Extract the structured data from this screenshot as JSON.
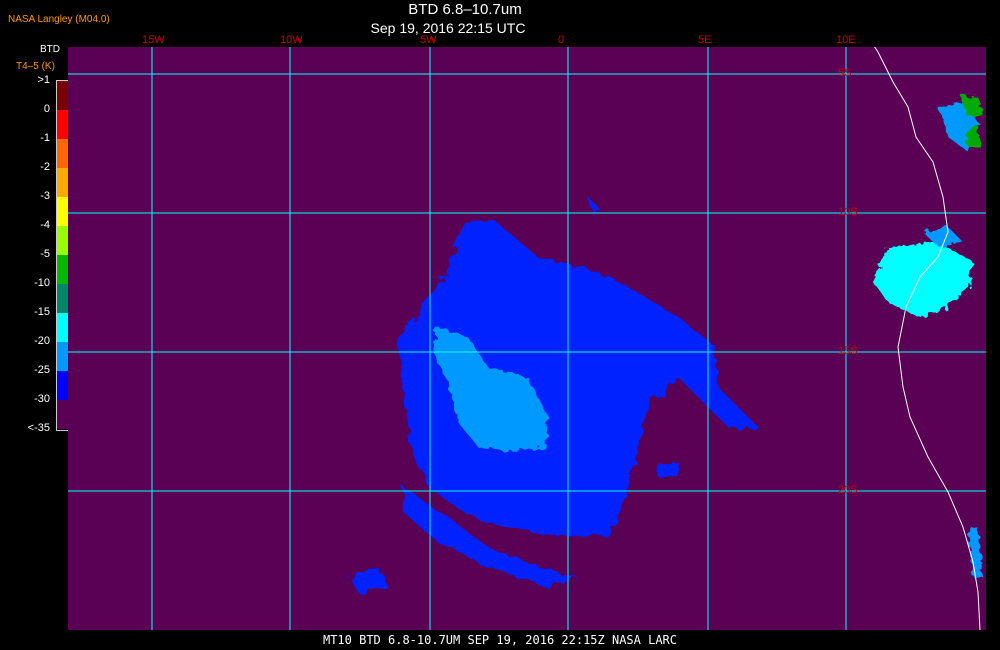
{
  "header": {
    "credit": "NASA Langley (M04.0)",
    "title": "BTD 6.8–10.7um",
    "timestamp": "Sep 19, 2016 22:15 UTC"
  },
  "legend": {
    "header": "BTD",
    "units": "T4–5 (K)",
    "colors": [
      "#7a0000",
      "#ff0000",
      "#ff6600",
      "#ffaa00",
      "#ffff00",
      "#99ff00",
      "#00bb00",
      "#008866",
      "#00ffff",
      "#0099ff",
      "#0000ff",
      "#5a0055"
    ],
    "labels": [
      ">1",
      "0",
      "-1",
      "-2",
      "-3",
      "-4",
      "-5",
      "-10",
      "-15",
      "-20",
      "-25",
      "-30",
      "<-35"
    ]
  },
  "map": {
    "lon_labels": [
      "15W",
      "10W",
      "5W",
      "0",
      "5E",
      "10E"
    ],
    "lat_labels": [
      "5S",
      "10S",
      "15S",
      "20S"
    ],
    "background_color": "#5a0055",
    "grid_color": "#00ffff",
    "coast_color": "#ffffff"
  },
  "footer": {
    "text": "MT10  BTD 6.8-10.7UM   SEP 19, 2016 22:15Z  NASA LARC"
  }
}
